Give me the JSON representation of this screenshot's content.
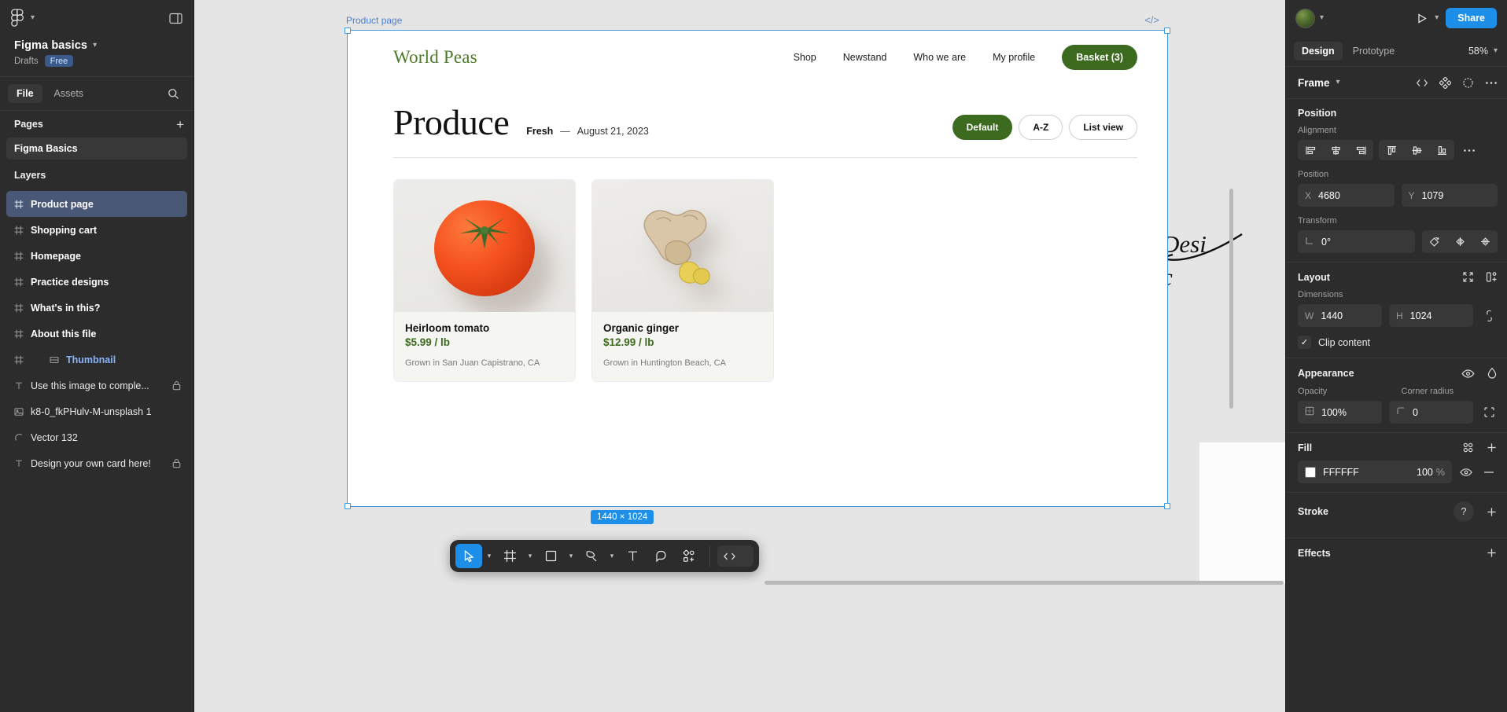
{
  "left_panel": {
    "logo_icon": "figma-logo-icon",
    "file_title": "Figma basics",
    "location": "Drafts",
    "plan_badge": "Free",
    "tabs": [
      {
        "label": "File",
        "active": true
      },
      {
        "label": "Assets",
        "active": false
      }
    ],
    "search_icon": "search-icon",
    "pages_heading": "Pages",
    "pages_add_icon": "plus-icon",
    "pages": [
      {
        "label": "Figma Basics",
        "selected": true
      }
    ],
    "layers_heading": "Layers",
    "layers": [
      {
        "label": "Product page",
        "kind": "frame",
        "selected": true,
        "locked": false,
        "indent": 0
      },
      {
        "label": "Shopping cart",
        "kind": "frame",
        "selected": false,
        "locked": false,
        "indent": 0
      },
      {
        "label": "Homepage",
        "kind": "frame",
        "selected": false,
        "locked": false,
        "indent": 0
      },
      {
        "label": "Practice designs",
        "kind": "frame",
        "selected": false,
        "locked": false,
        "indent": 0
      },
      {
        "label": "What's in this?",
        "kind": "frame",
        "selected": false,
        "locked": false,
        "indent": 0
      },
      {
        "label": "About this file",
        "kind": "frame",
        "selected": false,
        "locked": false,
        "indent": 0
      },
      {
        "label": "Thumbnail",
        "kind": "component",
        "selected": false,
        "locked": false,
        "indent": 1
      },
      {
        "label": "Use this image to comple...",
        "kind": "text",
        "selected": false,
        "locked": true,
        "indent": 0
      },
      {
        "label": "k8-0_fkPHulv-M-unsplash 1",
        "kind": "image",
        "selected": false,
        "locked": false,
        "indent": 0
      },
      {
        "label": "Vector 132",
        "kind": "vector",
        "selected": false,
        "locked": false,
        "indent": 0
      },
      {
        "label": "Design your own card here!",
        "kind": "text",
        "selected": false,
        "locked": true,
        "indent": 0
      }
    ]
  },
  "canvas": {
    "frame_label": "Product page",
    "code_icon": "code-icon",
    "dimension_badge": "1440 × 1024",
    "annotation_text": "Design\nc",
    "site": {
      "brand": "World Peas",
      "nav_links": [
        "Shop",
        "Newstand",
        "Who we are",
        "My profile"
      ],
      "basket_label": "Basket (3)",
      "page_title": "Produce",
      "meta_tag": "Fresh",
      "meta_dash": "—",
      "meta_date": "August 21, 2023",
      "pills": [
        {
          "label": "Default",
          "active": true
        },
        {
          "label": "A-Z",
          "active": false
        },
        {
          "label": "List view",
          "active": false
        }
      ],
      "products": [
        {
          "name": "Heirloom tomato",
          "price": "$5.99 / lb",
          "origin": "Grown in San Juan Capistrano, CA",
          "image": "tomato"
        },
        {
          "name": "Organic ginger",
          "price": "$12.99 / lb",
          "origin": "Grown in Huntington Beach, CA",
          "image": "ginger"
        }
      ]
    },
    "toolbar": [
      {
        "icon": "move-cursor-icon",
        "active": true,
        "chevron": true
      },
      {
        "icon": "frame-icon",
        "active": false,
        "chevron": true
      },
      {
        "icon": "rectangle-icon",
        "active": false,
        "chevron": true
      },
      {
        "icon": "pen-icon",
        "active": false,
        "chevron": true
      },
      {
        "icon": "text-tool-icon",
        "active": false,
        "chevron": false
      },
      {
        "icon": "comment-icon",
        "active": false,
        "chevron": false
      },
      {
        "icon": "add-component-icon",
        "active": false,
        "chevron": false
      }
    ],
    "toolbar_code_icon": "dev-mode-code-icon"
  },
  "right_panel": {
    "avatar_icon": "user-avatar",
    "present_icon": "present-play-icon",
    "share_label": "Share",
    "tabs": [
      {
        "label": "Design",
        "active": true
      },
      {
        "label": "Prototype",
        "active": false
      }
    ],
    "zoom_level": "58%",
    "selection": {
      "type": "Frame",
      "icons": [
        "code-icon",
        "create-component-icon",
        "reset-instance-icon",
        "more-options-icon"
      ]
    },
    "position": {
      "title": "Position",
      "alignment_label": "Alignment",
      "align_icons": [
        "align-left-icon",
        "align-horizontal-center-icon",
        "align-right-icon",
        "align-top-icon",
        "align-vertical-center-icon",
        "align-bottom-icon"
      ],
      "more_icon": "more-options-icon",
      "position_label": "Position",
      "x_key": "X",
      "x_value": "4680",
      "y_key": "Y",
      "y_value": "1079",
      "transform_label": "Transform",
      "rotation_value": "0°",
      "transform_icons": [
        "rotate-icon",
        "flip-horizontal-icon",
        "flip-vertical-icon"
      ]
    },
    "layout": {
      "title": "Layout",
      "icons": [
        "resize-to-fit-icon",
        "add-auto-layout-icon"
      ],
      "dimensions_label": "Dimensions",
      "w_key": "W",
      "w_value": "1440",
      "h_key": "H",
      "h_value": "1024",
      "ratio_icon": "lock-aspect-ratio-icon",
      "clip_content_label": "Clip content",
      "clip_content_checked": true
    },
    "appearance": {
      "title": "Appearance",
      "icons": [
        "visibility-eye-icon",
        "blend-mode-icon"
      ],
      "opacity_label": "Opacity",
      "opacity_value": "100%",
      "corner_radius_label": "Corner radius",
      "corner_radius_value": "0",
      "independent_corners_icon": "independent-corners-icon"
    },
    "fill": {
      "title": "Fill",
      "icons": [
        "styles-icon",
        "add-fill-icon"
      ],
      "color_hex": "FFFFFF",
      "opacity": "100",
      "opacity_unit": "%",
      "visibility_icon": "visibility-eye-icon",
      "remove_icon": "remove-fill-icon"
    },
    "stroke": {
      "title": "Stroke",
      "add_icon": "add-stroke-icon",
      "help_icon": "help-icon"
    },
    "effects": {
      "title": "Effects",
      "add_icon": "add-effect-icon"
    }
  },
  "colors": {
    "accent_blue": "#1E8FE8",
    "brand_green": "#3C6B1F",
    "selection_blue": "#3D9AE0",
    "panel_bg": "#2C2C2C",
    "canvas_bg": "#E5E5E5"
  }
}
